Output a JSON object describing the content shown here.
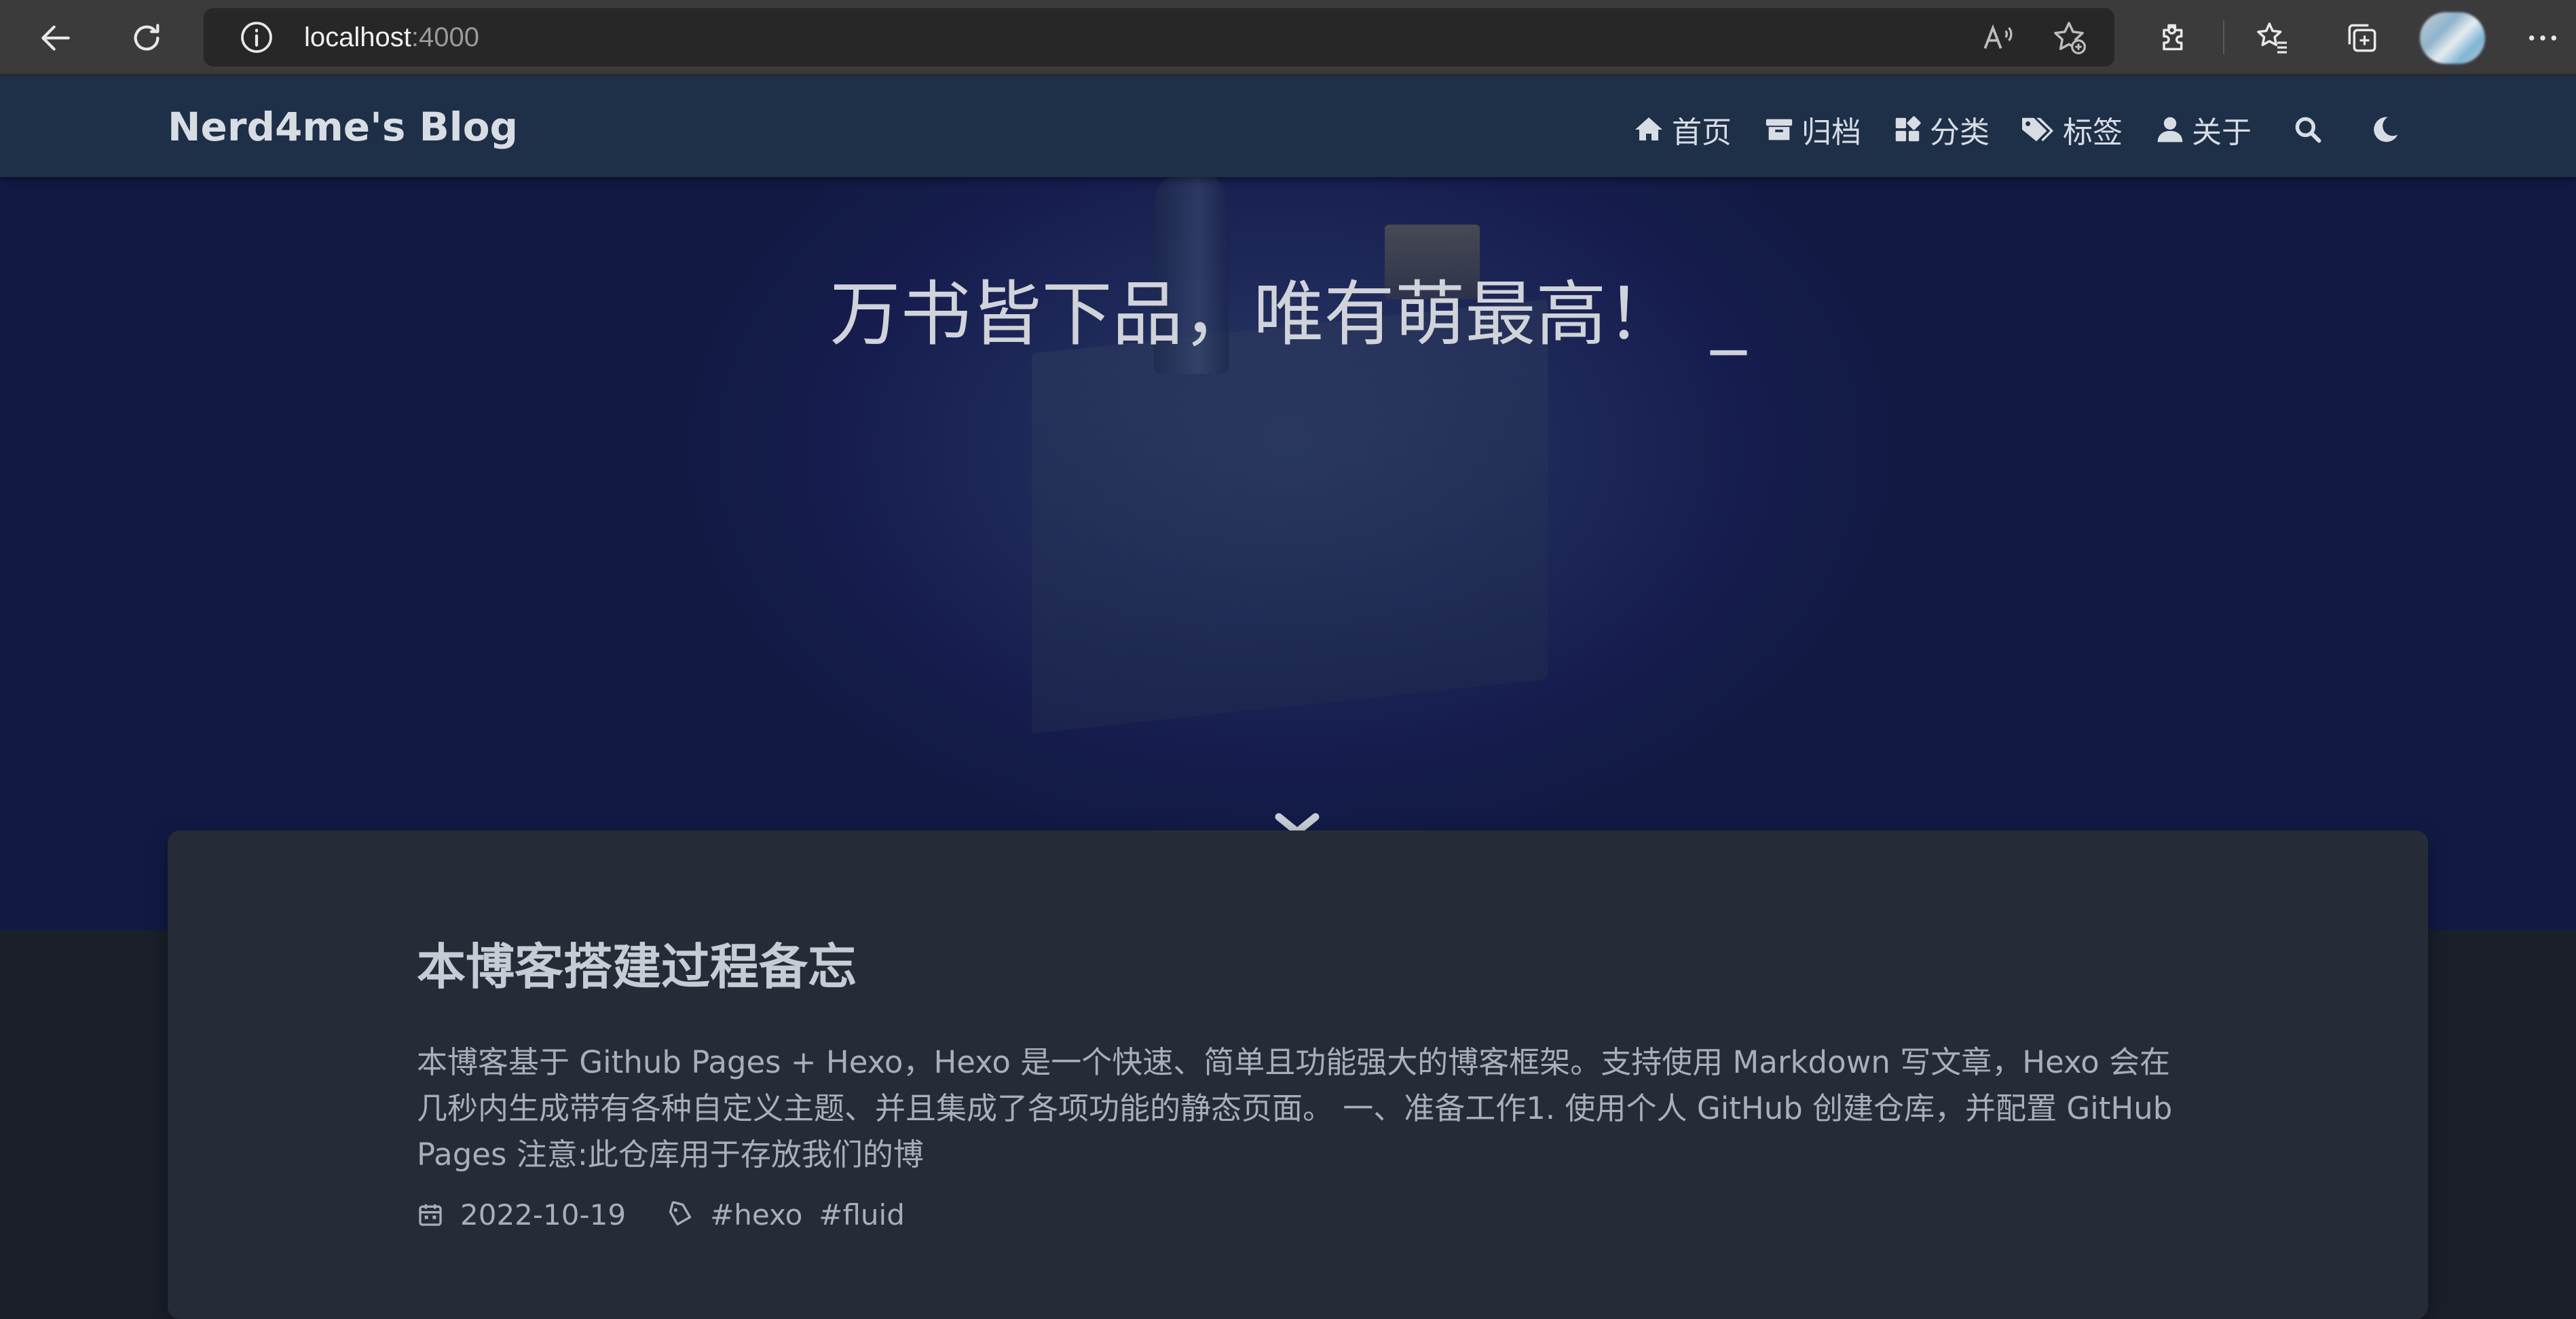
{
  "browser": {
    "url_host": "localhost",
    "url_port": ":4000"
  },
  "site": {
    "brand": "Nerd4me's Blog",
    "nav": [
      {
        "label": "首页",
        "icon": "home-icon"
      },
      {
        "label": "归档",
        "icon": "archive-icon"
      },
      {
        "label": "分类",
        "icon": "categories-icon"
      },
      {
        "label": "标签",
        "icon": "tags-icon"
      },
      {
        "label": "关于",
        "icon": "user-icon"
      }
    ]
  },
  "hero": {
    "slogan": "万书皆下品，唯有萌最高！",
    "cursor": "_"
  },
  "post": {
    "title": "本博客搭建过程备忘",
    "excerpt": "本博客基于 Github Pages + Hexo，Hexo 是一个快速、简单且功能强大的博客框架。支持使用 Markdown 写文章，Hexo 会在几秒内生成带有各种自定义主题、并且集成了各项功能的静态页面。 一、准备工作1. 使用个人 GitHub 创建仓库，并配置 GitHub Pages 注意:此仓库用于存放我们的博",
    "date": "2022-10-19",
    "tags": [
      "#hexo",
      "#fluid"
    ]
  }
}
